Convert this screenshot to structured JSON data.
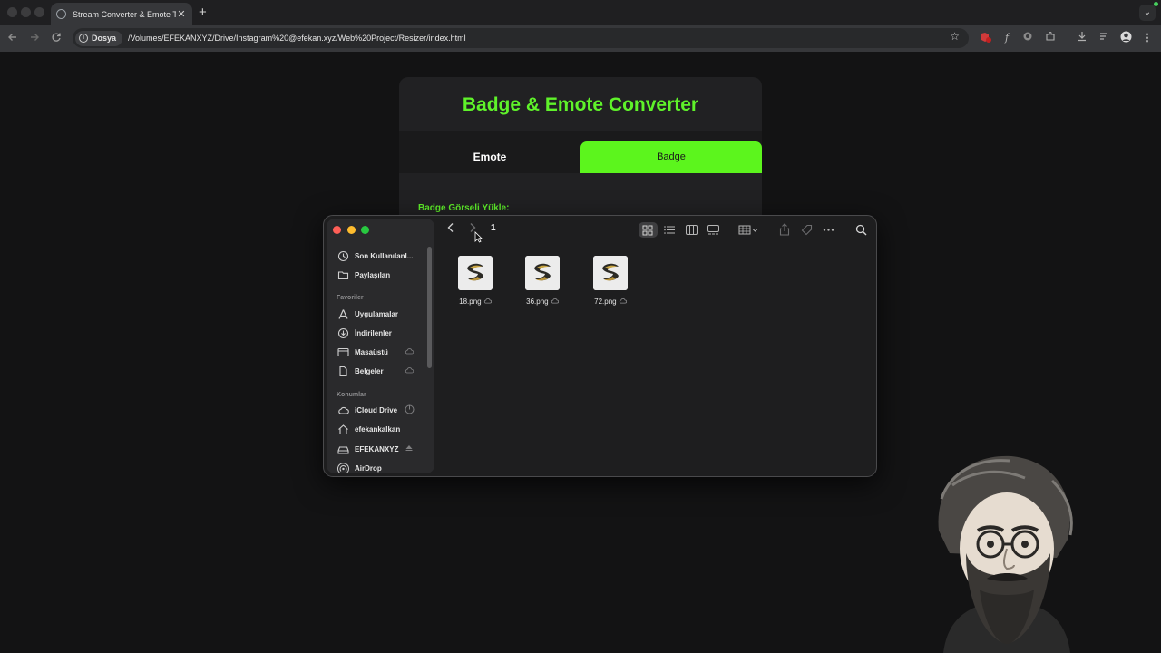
{
  "browser": {
    "tab_title": "Stream Converter & Emote To",
    "tab_close": "✕",
    "new_tab": "+",
    "address_chip": "Dosya",
    "url": "/Volumes/EFEKANXYZ/Drive/Instagram%20@efekan.xyz/Web%20Project/Resizer/index.html"
  },
  "page": {
    "title": "Badge & Emote Converter",
    "tabs": [
      {
        "label": "Emote",
        "active": false
      },
      {
        "label": "Badge",
        "active": true
      }
    ],
    "upload_label": "Badge Görseli Yükle:",
    "accent": "#5ff22a"
  },
  "finder": {
    "folder": "1",
    "sidebar": {
      "top_items": [
        {
          "label": "Son Kullanılanl...",
          "icon": "clock-icon"
        },
        {
          "label": "Paylaşılan",
          "icon": "shared-folder-icon"
        }
      ],
      "favorites_header": "Favoriler",
      "favorites": [
        {
          "label": "Uygulamalar",
          "icon": "applications-icon"
        },
        {
          "label": "İndirilenler",
          "icon": "downloads-icon"
        },
        {
          "label": "Masaüstü",
          "icon": "desktop-icon"
        },
        {
          "label": "Belgeler",
          "icon": "document-icon"
        }
      ],
      "locations_header": "Konumlar",
      "locations": [
        {
          "label": "iCloud Drive",
          "icon": "icloud-icon"
        },
        {
          "label": "efekankalkan",
          "icon": "home-icon"
        },
        {
          "label": "EFEKANXYZ",
          "icon": "drive-icon"
        },
        {
          "label": "AirDrop",
          "icon": "airdrop-icon"
        }
      ]
    },
    "files": [
      {
        "name": "18.png"
      },
      {
        "name": "36.png"
      },
      {
        "name": "72.png"
      }
    ]
  }
}
